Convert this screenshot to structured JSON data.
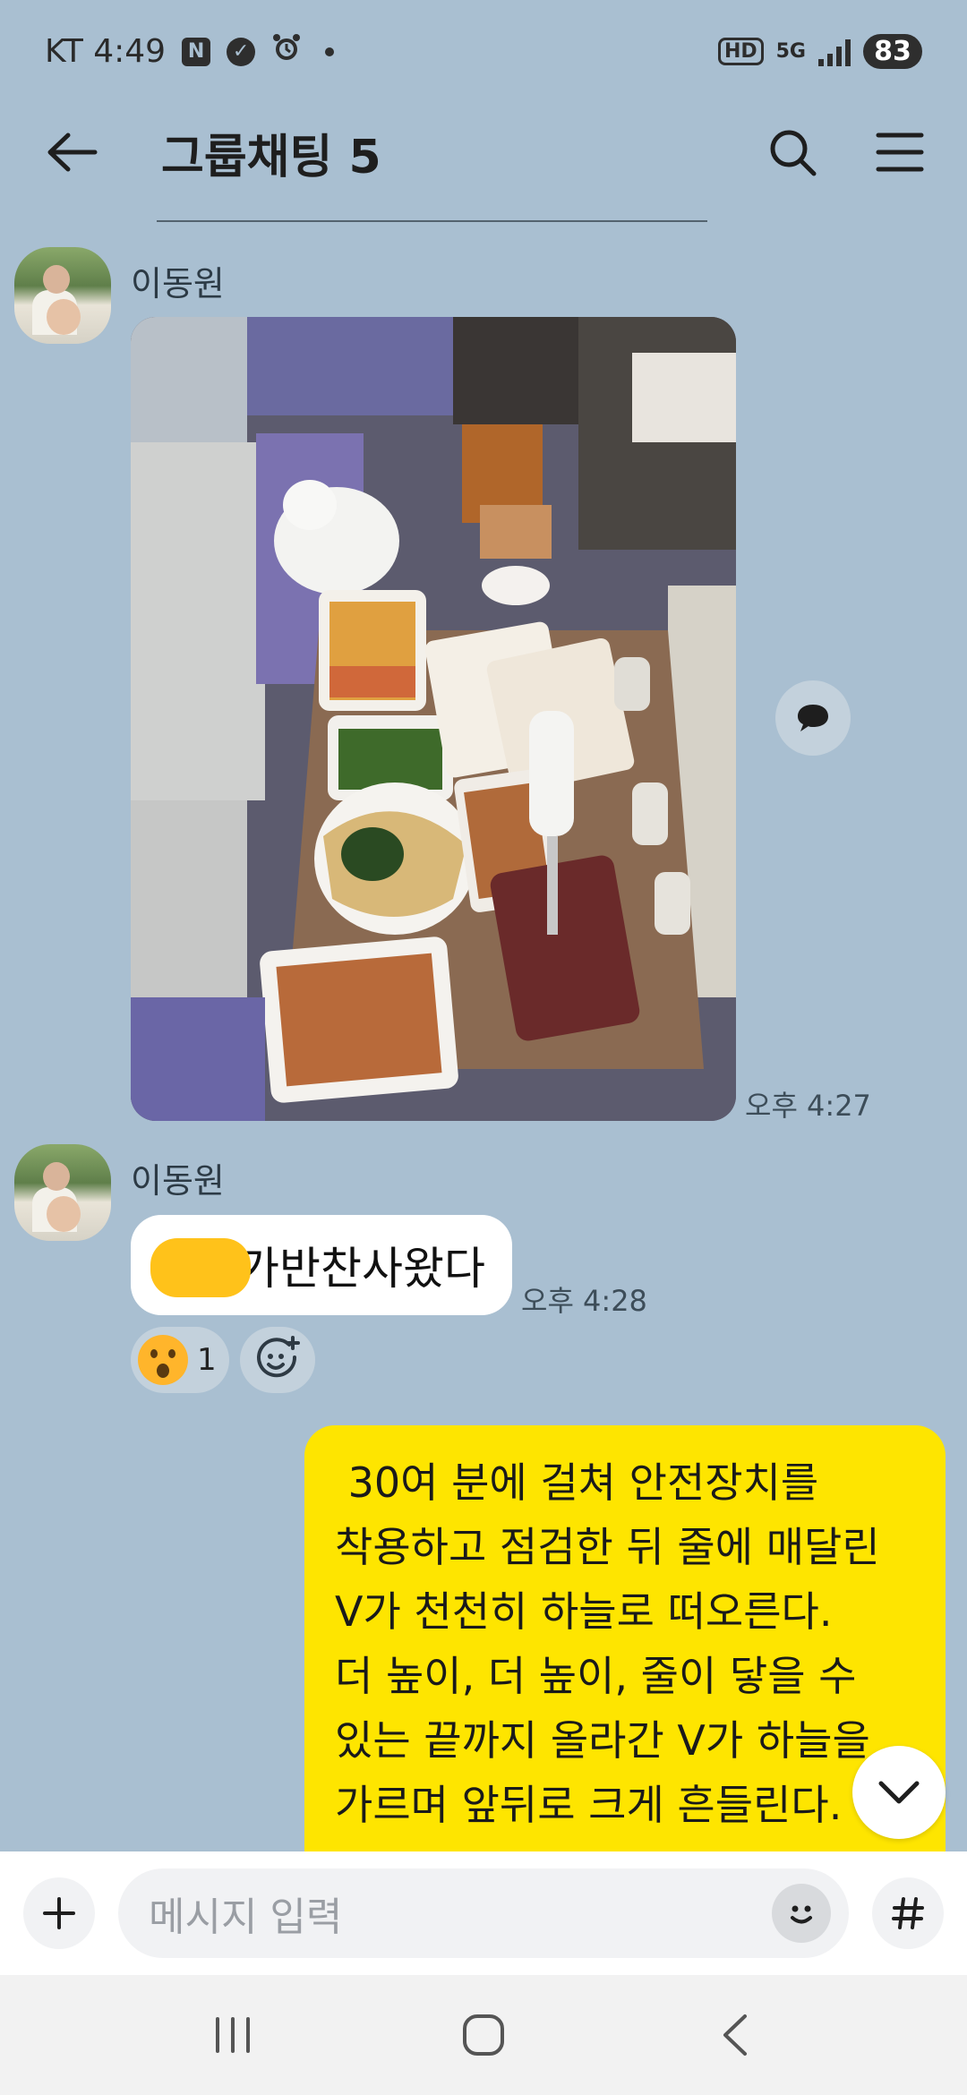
{
  "status_bar": {
    "carrier_time": "KT 4:49",
    "icons": [
      "naver-icon",
      "check-badge-icon",
      "alarm-icon",
      "dot-icon"
    ],
    "hd": "HD",
    "network": "5G",
    "battery": "83"
  },
  "header": {
    "title": "그룹채팅 5"
  },
  "messages": [
    {
      "sender": "이동원",
      "type": "photo",
      "time": "오후 4:27"
    },
    {
      "sender": "이동원",
      "type": "text",
      "text": "가반찬사왔다",
      "time": "오후 4:28",
      "reaction": {
        "emoji": "surprised-face-icon",
        "count": "1"
      }
    }
  ],
  "my_message": {
    "lines": [
      " 30여 분에 걸쳐 안전장치를",
      "착용하고 점검한 뒤 줄에 매달린",
      "V가 천천히 하늘로 떠오른다.",
      "더 높이, 더 높이, 줄이 닿을 수",
      "있는 끝까지 올라간 V가 하늘을",
      "가르며 앞뒤로 크게 흔들린다."
    ]
  },
  "input": {
    "placeholder": "메시지 입력"
  },
  "colors": {
    "background": "#a9bfd1",
    "my_bubble": "#fee500",
    "other_bubble": "#ffffff"
  }
}
